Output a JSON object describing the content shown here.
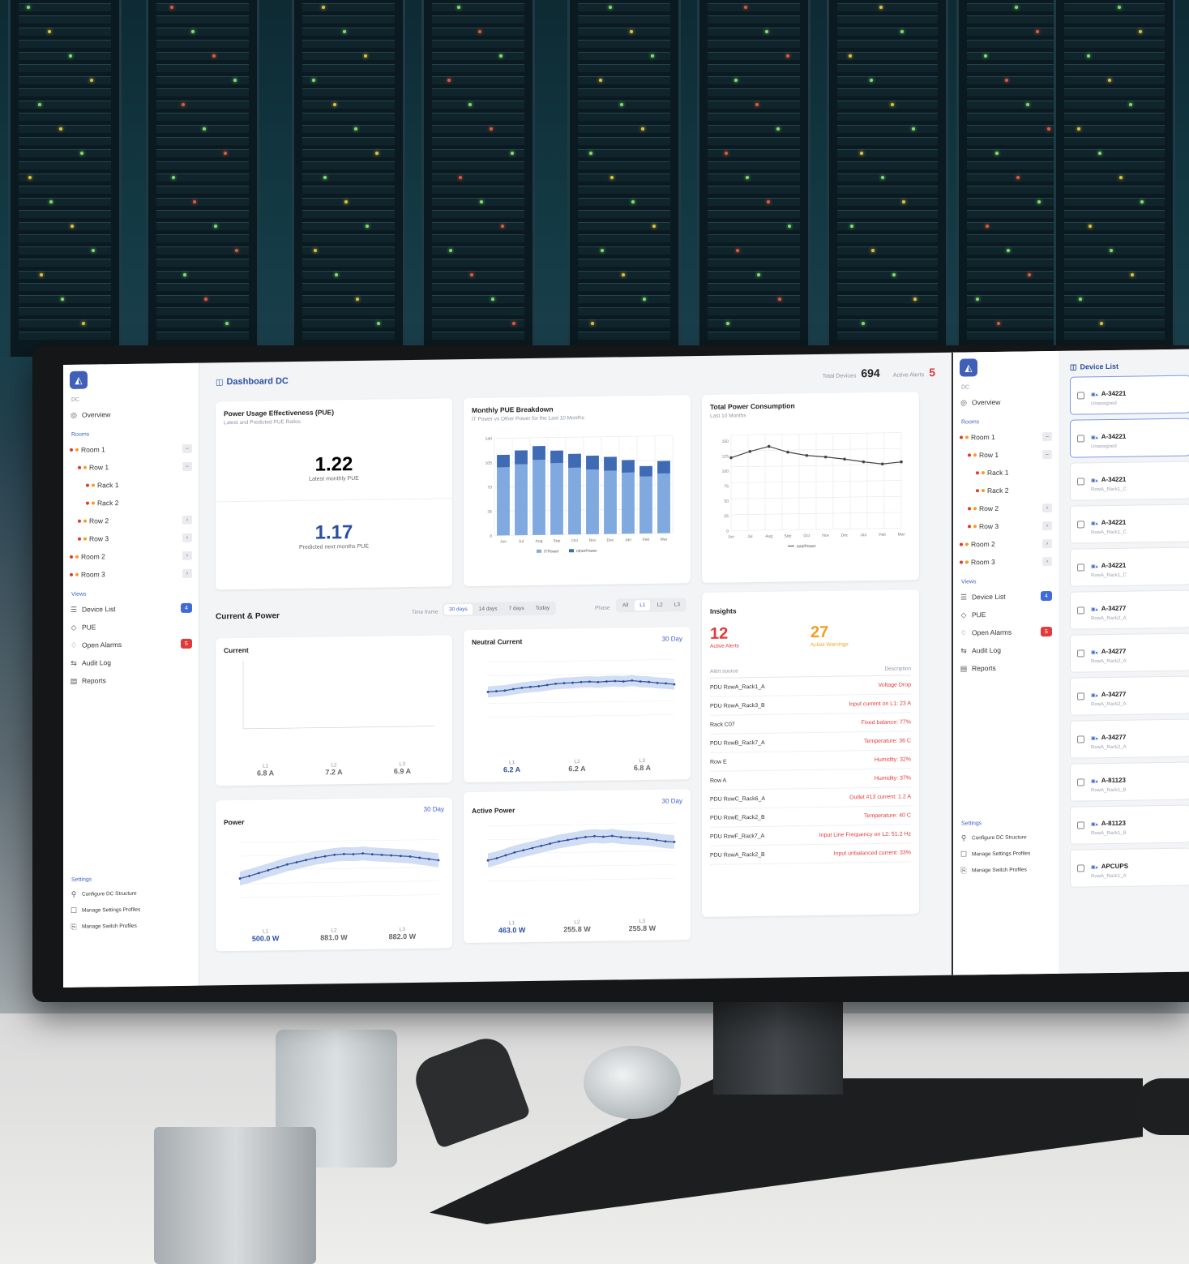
{
  "header": {
    "title": "Dashboard DC",
    "total_devices_label": "Total Devices",
    "total_devices": "694",
    "active_alerts_label": "Active Alerts",
    "active_alerts": "5"
  },
  "sidebar": {
    "dc_label": "DC",
    "overview": "Overview",
    "rooms_label": "Rooms",
    "tree": [
      {
        "label": "Room 1",
        "indent": 0
      },
      {
        "label": "Row 1",
        "indent": 1
      },
      {
        "label": "Rack 1",
        "indent": 2
      },
      {
        "label": "Rack 2",
        "indent": 2
      },
      {
        "label": "Row 2",
        "indent": 1
      },
      {
        "label": "Row 3",
        "indent": 1
      },
      {
        "label": "Room 2",
        "indent": 0
      },
      {
        "label": "Room 3",
        "indent": 0
      }
    ],
    "views_label": "Views",
    "views": [
      {
        "label": "Device List",
        "icon": "list-icon",
        "badge": "4"
      },
      {
        "label": "PUE",
        "icon": "pue-icon",
        "badge": ""
      },
      {
        "label": "Open Alarms",
        "icon": "bell-icon",
        "badge": "5"
      },
      {
        "label": "Audit Log",
        "icon": "log-icon",
        "badge": ""
      },
      {
        "label": "Reports",
        "icon": "report-icon",
        "badge": ""
      }
    ],
    "settings_label": "Settings",
    "settings": [
      "Configure DC Structure",
      "Manage Settings Profiles",
      "Manage Switch Profiles"
    ]
  },
  "pue": {
    "title": "Power Usage Effectiveness (PUE)",
    "subtitle": "Latest and Predicted PUE Ratios",
    "latest": "1.22",
    "latest_label": "Latest monthly PUE",
    "predicted": "1.17",
    "predicted_label": "Predicted next months PUE"
  },
  "monthly_pue": {
    "title": "Monthly PUE Breakdown",
    "subtitle": "IT Power vs Other Power for the Last 10 Months"
  },
  "total_power": {
    "title": "Total Power Consumption",
    "subtitle": "Last 10 Months"
  },
  "current_power": {
    "title": "Current & Power",
    "time_frame_label": "Time frame",
    "time_frames": [
      "30 days",
      "14 days",
      "7 days",
      "Today"
    ],
    "phase_label": "Phase",
    "phases": [
      "All",
      "L1",
      "L2",
      "L3"
    ]
  },
  "current_card": {
    "title": "Current",
    "phases": [
      {
        "name": "L1",
        "value": "6.8 A"
      },
      {
        "name": "L2",
        "value": "7.2 A"
      },
      {
        "name": "L3",
        "value": "6.9 A"
      }
    ]
  },
  "neutral_card": {
    "title": "Neutral Current",
    "range": "30 Day",
    "phases": [
      {
        "name": "L1",
        "value": "6.2 A"
      },
      {
        "name": "L2",
        "value": "6.2 A"
      },
      {
        "name": "L3",
        "value": "6.8 A"
      }
    ]
  },
  "power_card": {
    "title": "Power",
    "range": "30 Day",
    "phases": [
      {
        "name": "L1",
        "value": "500.0 W"
      },
      {
        "name": "L2",
        "value": "881.0 W"
      },
      {
        "name": "L3",
        "value": "882.0 W"
      }
    ]
  },
  "active_power_card": {
    "title": "Active Power",
    "range": "30 Day",
    "phases": [
      {
        "name": "L1",
        "value": "463.0 W"
      },
      {
        "name": "L2",
        "value": "255.8 W"
      },
      {
        "name": "L3",
        "value": "255.8 W"
      }
    ]
  },
  "insights": {
    "title": "Insights",
    "alerts_count": "12",
    "alerts_label": "Active Alerts",
    "warnings_count": "27",
    "warnings_label": "Active Warnings",
    "col_source": "Alert source",
    "col_desc": "Description",
    "rows": [
      {
        "source": "PDU RowA_Rack1_A",
        "desc": "Voltage Drop"
      },
      {
        "source": "PDU RowA_Rack3_B",
        "desc": "Input current on L1: 23 A"
      },
      {
        "source": "Rack C07",
        "desc": "Fixed balance: 77%"
      },
      {
        "source": "PDU RowB_Rack7_A",
        "desc": "Temperature: 36 C"
      },
      {
        "source": "Row E",
        "desc": "Humidity: 32%"
      },
      {
        "source": "Row A",
        "desc": "Humidity: 37%"
      },
      {
        "source": "PDU RowC_Rack6_A",
        "desc": "Outlet #13 current: 1.2 A"
      },
      {
        "source": "PDU RowE_Rack2_B",
        "desc": "Temperature: 40 C"
      },
      {
        "source": "PDU RowF_Rack7_A",
        "desc": "Input Line Frequency on L2: 51.2 Hz"
      },
      {
        "source": "PDU RowA_Rack2_B",
        "desc": "Input unbalanced current: 33%"
      }
    ]
  },
  "device_list": {
    "title": "Device List",
    "items": [
      {
        "name": "A-34221",
        "sub": "Unassigned",
        "selected": true
      },
      {
        "name": "A-34221",
        "sub": "Unassigned",
        "selected": true
      },
      {
        "name": "A-34221",
        "sub": "RowA_Rack1_C",
        "selected": false
      },
      {
        "name": "A-34221",
        "sub": "RowA_Rack1_C",
        "selected": false
      },
      {
        "name": "A-34221",
        "sub": "RowA_Rack1_C",
        "selected": false
      },
      {
        "name": "A-34277",
        "sub": "RowA_Rack2_A",
        "selected": false
      },
      {
        "name": "A-34277",
        "sub": "RowA_Rack2_A",
        "selected": false
      },
      {
        "name": "A-34277",
        "sub": "RowA_Rack2_A",
        "selected": false
      },
      {
        "name": "A-34277",
        "sub": "RowA_Rack2_A",
        "selected": false
      },
      {
        "name": "A-81123",
        "sub": "RowA_Rack1_B",
        "selected": false
      },
      {
        "name": "A-81123",
        "sub": "RowA_Rack1_B",
        "selected": false
      },
      {
        "name": "APCUPS",
        "sub": "RowA_Rack1_A",
        "selected": false
      }
    ]
  },
  "chart_data": [
    {
      "type": "bar",
      "title": "Monthly PUE Breakdown",
      "categories": [
        "Jun",
        "Jul",
        "Aug",
        "Sep",
        "Oct",
        "Nov",
        "Dec",
        "Jan",
        "Feb",
        "Mar"
      ],
      "series": [
        {
          "name": "ITPower",
          "values": [
            98,
            102,
            108,
            103,
            96,
            93,
            91,
            88,
            82,
            86
          ]
        },
        {
          "name": "otherPower",
          "values": [
            18,
            20,
            20,
            18,
            20,
            20,
            20,
            18,
            15,
            18
          ]
        }
      ],
      "ylim": [
        0,
        140
      ],
      "yticks": [
        0,
        35,
        70,
        105,
        140
      ]
    },
    {
      "type": "line",
      "title": "Total Power Consumption",
      "categories": [
        "Jun",
        "Jul",
        "Aug",
        "Sep",
        "Oct",
        "Nov",
        "Dec",
        "Jan",
        "Feb",
        "Mar"
      ],
      "series": [
        {
          "name": "totalPower",
          "values": [
            122,
            132,
            140,
            130,
            124,
            121,
            117,
            112,
            108,
            111
          ]
        }
      ],
      "ylim": [
        0,
        160
      ],
      "yticks": [
        0,
        25,
        50,
        75,
        100,
        125,
        150
      ]
    },
    {
      "type": "line",
      "title": "Neutral Current",
      "series": [
        {
          "name": "",
          "values": [
            9.2,
            9.4,
            9.6,
            10.1,
            10.5,
            10.8,
            11.0,
            11.4,
            11.8,
            12.0,
            12.1,
            12.3,
            12.4,
            12.2,
            12.4,
            12.5,
            12.3,
            12.6,
            12.2,
            12.0,
            11.6,
            11.4,
            11.0
          ]
        }
      ],
      "ylim": [
        0,
        20
      ]
    },
    {
      "type": "line",
      "title": "Power",
      "series": [
        {
          "name": "",
          "values": [
            5.5,
            6.2,
            7.0,
            7.8,
            8.6,
            9.4,
            10.0,
            10.6,
            11.2,
            11.6,
            12.0,
            12.2,
            12.1,
            12.3,
            12.0,
            11.8,
            11.6,
            11.4,
            11.2,
            10.8,
            10.4,
            10.0
          ]
        }
      ],
      "ylim": [
        0,
        16
      ]
    },
    {
      "type": "line",
      "title": "Active Power",
      "series": [
        {
          "name": "",
          "values": [
            6.0,
            6.6,
            7.4,
            8.2,
            8.8,
            9.4,
            10.0,
            10.6,
            11.2,
            11.6,
            12.0,
            12.4,
            12.6,
            12.4,
            12.6,
            12.2,
            12.0,
            11.8,
            11.6,
            11.2,
            10.8,
            10.6
          ]
        }
      ],
      "ylim": [
        0,
        16
      ]
    }
  ]
}
